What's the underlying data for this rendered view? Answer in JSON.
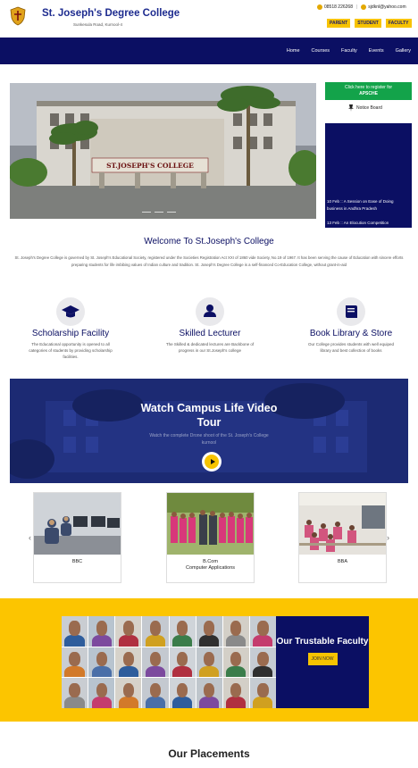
{
  "header": {
    "college_name": "St. Joseph's Degree College",
    "address": "Sunkesula Road, Kurnool-4",
    "phone": "08518 226268",
    "email": "sjdknl@yahoo.com",
    "role_buttons": [
      "PARENT",
      "STUDENT",
      "FACULTY"
    ]
  },
  "nav": {
    "items": [
      "Home",
      "Courses",
      "Faculty",
      "Events",
      "Gallery"
    ]
  },
  "hero": {
    "sign_text": "ST.JOSEPH'S  COLLEGE"
  },
  "register": {
    "line1": "Click here to register for",
    "line2": "APSCHE"
  },
  "notice": {
    "label": "Notice Board",
    "items": [
      "10 Feb :: A Session on Ease of Doing",
      "business in Andhra Pradesh",
      "13 Feb :: An Elocution Competition"
    ]
  },
  "welcome": {
    "title": "Welcome To St.Joseph's College",
    "text": "St. Joseph's Degree College is governed by St. Joseph's Educational Society, registered under the Societies Registration Act XXI of 1860 vide Society, No.19 of 1967. It has been serving the cause of Education with sincere efforts preparing students for life imbibing values of Indian culture and tradition. St. Joseph's Degree College is a self-financed Co-Education College, without grant-in-aid"
  },
  "features": [
    {
      "icon": "graduation-cap-icon",
      "title": "Scholarship Facility",
      "desc": "The Educational opportunity is opened to all categories of students by providing scholarship facilities."
    },
    {
      "icon": "user-icon",
      "title": "Skilled Lecturer",
      "desc": "The Skilled & dedicated lectures are Backbone of progress in our St.Joseph's college"
    },
    {
      "icon": "book-icon",
      "title": "Book Library & Store",
      "desc": "Our College provides students with well equiped library and best collection of books"
    }
  ],
  "video": {
    "title": "Watch Campus Life Video Tour",
    "subtitle": "Watch the complete Drone shoot of the St. Joseph's College kurnool"
  },
  "courses": [
    {
      "label": "BBC"
    },
    {
      "label": "B.Com\nComputer Applications"
    },
    {
      "label": "BBA"
    }
  ],
  "faculty": {
    "title": "Our Trustable Faculty",
    "button": "JOIN NOW"
  },
  "placements": {
    "title": "Our Placements"
  },
  "colors": {
    "navy": "#0b0f63",
    "yellow": "#fcc500",
    "green": "#13a34a"
  }
}
